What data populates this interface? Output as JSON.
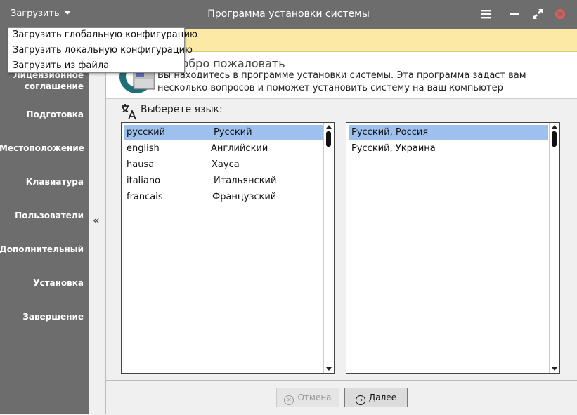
{
  "app": {
    "menu_label": "Загрузить",
    "window_title": "Программа установки системы"
  },
  "dropdown": {
    "items": [
      "Загрузить глобальную конфигурацию",
      "Загрузить локальную конфигурацию",
      "Загрузить из файла"
    ]
  },
  "sidebar": {
    "items": [
      {
        "label": "Лицензионное соглашение"
      },
      {
        "label": "Подготовка"
      },
      {
        "label": "Местоположение"
      },
      {
        "label": "Клавиатура"
      },
      {
        "label": "Пользователи"
      },
      {
        "label": "Дополнительный"
      },
      {
        "label": "Установка"
      },
      {
        "label": "Завершение"
      }
    ],
    "collapse_glyph": "«"
  },
  "welcome": {
    "title": "Добро пожаловать",
    "text": "Вы находитесь в программе установки системы. Эта программа задаст вам несколько вопросов и поможет установить систему на ваш компьютер"
  },
  "language": {
    "label": "Выберете язык:",
    "languages": [
      {
        "code": "русский",
        "name": "Русский",
        "selected": true
      },
      {
        "code": "english",
        "name": "Английский",
        "selected": false
      },
      {
        "code": "hausa",
        "name": "Хауса",
        "selected": false
      },
      {
        "code": "italiano",
        "name": "Итальянский",
        "selected": false
      },
      {
        "code": "francais",
        "name": "Французский",
        "selected": false
      }
    ],
    "locales": [
      {
        "name": "Русский, Россия",
        "selected": true
      },
      {
        "name": "Русский, Украина",
        "selected": false
      }
    ]
  },
  "footer": {
    "cancel_label": "Отмена",
    "next_label": "Далее"
  },
  "colors": {
    "sidebar_bg": "#6d6d6d",
    "banner_bg": "#fde9a6",
    "selection": "#9dc0ef",
    "close_icon": "#e05a5a"
  }
}
